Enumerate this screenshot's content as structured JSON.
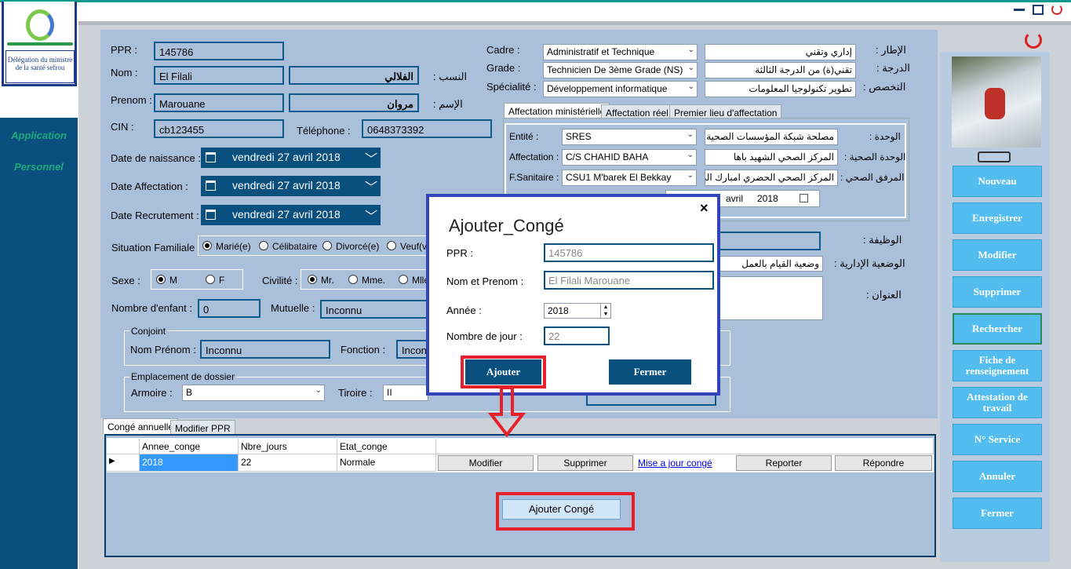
{
  "window": {
    "controls": [
      "minimize-icon",
      "restore-icon",
      "power-icon"
    ]
  },
  "logo": {
    "line1": "Délégation du ministre",
    "line2": "de la santé sefrou"
  },
  "sidebar": {
    "items": [
      {
        "label": "Application"
      },
      {
        "label": "Personnel"
      }
    ]
  },
  "form": {
    "ppr_label": "PPR :",
    "ppr_value": "145786",
    "nom_label": "Nom :",
    "nom_value": "El Filali",
    "nasab_label": "النسب :",
    "nasab_value": "الفلالي",
    "prenom_label": "Prenom :",
    "prenom_value": "Marouane",
    "ism_label": "الإسم :",
    "ism_value": "مروان",
    "cin_label": "CIN :",
    "cin_value": "cb123455",
    "tel_label": "Téléphone :",
    "tel_value": "0648373392",
    "dob_label": "Date de naissance :",
    "dob_value": "vendredi 27 avril 2018",
    "daff_label": "Date Affectation :",
    "daff_value": "vendredi 27 avril 2018",
    "drec_label": "Date Recrutement :",
    "drec_value": "vendredi 27 avril 2018",
    "sitfam_label": "Situation Familiale",
    "sitfam_options": [
      "Marié(e)",
      "Célibataire",
      "Divorcé(e)",
      "Veuf(ve)"
    ],
    "sexe_label": "Sexe :",
    "sexe_options": [
      "M",
      "F"
    ],
    "civ_label": "Civilité :",
    "civ_options": [
      "Mr.",
      "Mme.",
      "Mlle"
    ],
    "enfants_label": "Nombre d'enfant :",
    "enfants_value": "0",
    "mutuelle_label": "Mutuelle :",
    "mutuelle_value": "Inconnu",
    "conjoint_title": "Conjoint",
    "conj_nom_label": "Nom Prénom :",
    "conj_nom_value": "Inconnu",
    "conj_fonction_label": "Fonction :",
    "conj_fonction_value": "Inconnu",
    "emplacement_title": "Emplacement de dossier",
    "armoire_label": "Armoire :",
    "armoire_value": "B",
    "tiroire_label": "Tiroire :",
    "tiroire_value": "II"
  },
  "right": {
    "cadre_label": "Cadre :",
    "cadre_value": "Administratif et Technique",
    "itar_label": "الإطار :",
    "itar_value": "إداري وتقني",
    "grade_label": "Grade :",
    "grade_value": "Technicien De 3ème Grade (NS)",
    "daraja_label": "الدرجة :",
    "daraja_value": "تقني(ة) من الدرجة الثالثة",
    "spec_label": "Spécialité :",
    "spec_value": "Développement informatique",
    "takhasos_label": "التخصص :",
    "takhasos_value": "تطوير تكنولوجيا المعلومات",
    "tabs": [
      "Affectation ministérielle",
      "Affectation réel",
      "Premier lieu d'affectation"
    ],
    "entite_label": "Entité :",
    "entite_value": "SRES",
    "wahda_label": "الوحدة :",
    "wahda_value": "مصلحة شبكة المؤسسات الصحية",
    "affect_label": "Affectation :",
    "affect_value": "C/S CHAHID BAHA",
    "wahda_sihhia_label": "الوحدة الصحية :",
    "wahda_sihhia_value": "المركز الصحي الشهيد باها",
    "fsan_label": "F.Sanitaire :",
    "fsan_value": "CSU1 M'barek El Bekkay",
    "marfaq_label": "المرفق الصحي :",
    "marfaq_value": "المركز الصحي الحضري امبارك البكاي",
    "date_partial_month": "avril",
    "date_partial_year": "2018",
    "wadifa_label": "الوظيفة :",
    "wadiya_label": "الوضعية الإدارية :",
    "wadiya_value": "وضعية القيام بالعمل",
    "onwan_label": "العنوان :"
  },
  "buttons": [
    "Nouveau",
    "Enregistrer",
    "Modifier",
    "Supprimer",
    "Rechercher",
    "Fiche de renseignement",
    "Attestation de travail",
    "N° Service",
    "Annuler",
    "Fermer"
  ],
  "bottom_tabs": [
    "Congé annuelle",
    "Modifier PPR"
  ],
  "grid": {
    "headers": [
      "Annee_conge",
      "Nbre_jours",
      "Etat_conge"
    ],
    "row": [
      "2018",
      "22",
      "Normale"
    ],
    "actions": [
      "Modifier",
      "Supprimer",
      "Mise a jour congé",
      "Reporter",
      "Répondre"
    ],
    "add_button": "Ajouter Congé"
  },
  "dialog": {
    "title": "Ajouter_Congé",
    "close": "×",
    "ppr_label": "PPR :",
    "ppr_value": "145786",
    "nom_label": "Nom et Prenom :",
    "nom_value": "El Filali Marouane",
    "annee_label": "Année :",
    "annee_value": "2018",
    "jours_label": "Nombre de jour :",
    "jours_value": "22",
    "ajouter": "Ajouter",
    "fermer": "Fermer"
  },
  "colors": {
    "accent": "#0a507f",
    "highlight": "#e8202a",
    "dialog_border": "#3344bb",
    "button": "#53bdf0"
  }
}
